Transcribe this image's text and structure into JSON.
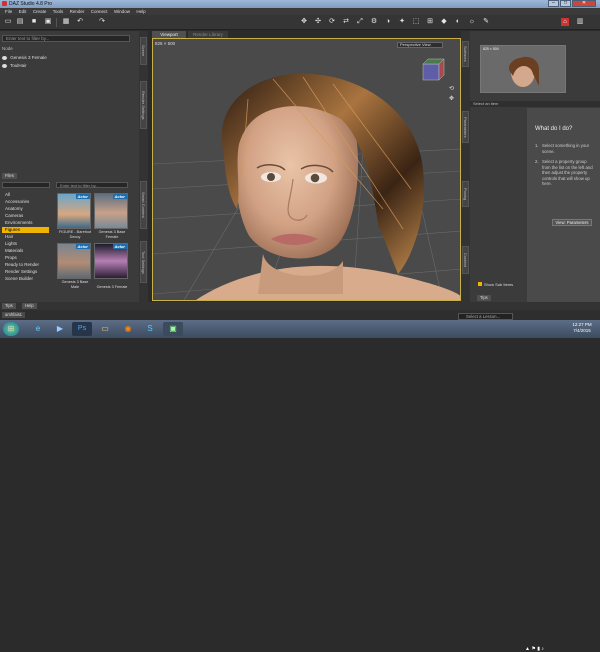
{
  "window": {
    "title": "DAZ Studio 4.8 Pro"
  },
  "menu": [
    "File",
    "Edit",
    "Create",
    "Tools",
    "Render",
    "Connect",
    "Window",
    "Help"
  ],
  "scene": {
    "filter_placeholder": "Enter text to filter by...",
    "column_header": "Node",
    "items": [
      "Genesis 3 Female",
      "ToulHair"
    ]
  },
  "viewport": {
    "tab_active": "Viewport",
    "tab_inactive": "Render Library",
    "resolution": "825 × 500",
    "camera": "Perspective View"
  },
  "left_vtabs": [
    "Scene",
    "Render Settings",
    "Smart Content",
    "Tool Settings"
  ],
  "files": {
    "filter_placeholder": "Enter text to filter by...",
    "categories": [
      "All",
      "Accessories",
      "Anatomy",
      "Cameras",
      "Environments",
      "Figures",
      "Hair",
      "Lights",
      "Materials",
      "Props",
      "Ready to Render",
      "Render Settings",
      "Scene Builder"
    ],
    "selected_category": 5,
    "products": [
      {
        "badge": "Actor",
        "caption": "FIGURE - Barefoot Decoy"
      },
      {
        "badge": "Actor",
        "caption": "Genesis 3 Base Female"
      },
      {
        "badge": "Actor",
        "caption": "Genesis 3 Base Male"
      },
      {
        "badge": "Actor",
        "caption": "Genesis 3 Female"
      }
    ],
    "tab": "Files"
  },
  "right": {
    "preview_label": "825 × 500",
    "vtabs": [
      "Surfaces",
      "Parameters",
      "Posing",
      "Content"
    ],
    "select_placeholder": "Select an item",
    "help_title": "What do I do?",
    "steps": [
      "Select something in your scene.",
      "Select a property group from the list on the left and then adjust the property controls that will show up here."
    ],
    "view_params_button": "View: Parameters",
    "show_sub_items": "Show Sub Items",
    "tips_tab": "Tips"
  },
  "bottom": {
    "left_tabs": [
      "Tips",
      "Help"
    ],
    "doc_tab": "amhfais1",
    "lesson_placeholder": "Select a Lesson..."
  },
  "taskbar": {
    "time": "12:27 PM",
    "date": "7/4/2015"
  }
}
